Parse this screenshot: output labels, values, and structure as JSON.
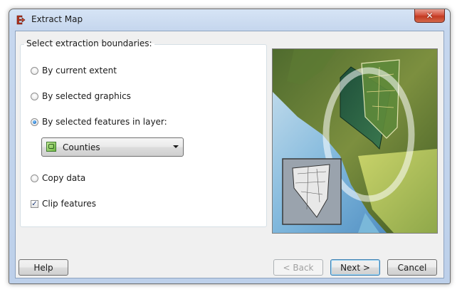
{
  "window": {
    "title": "Extract Map",
    "close_glyph": "✕",
    "app_icon": "extract-map-icon"
  },
  "group": {
    "legend": "Select extraction boundaries:"
  },
  "options": {
    "current_extent": "By current extent",
    "selected_graphics": "By selected graphics",
    "selected_features": "By selected features in layer:",
    "copy_data": "Copy data",
    "clip_features": "Clip features"
  },
  "state": {
    "selected_option": "selected_features",
    "clip_features_checked": true
  },
  "layer_dropdown": {
    "value": "Counties",
    "icon": "polygon-layer-icon"
  },
  "buttons": {
    "help": "Help",
    "back": "< Back",
    "next": "Next >",
    "cancel": "Cancel"
  },
  "colors": {
    "accent": "#2a7bd0",
    "close": "#c23a22"
  }
}
